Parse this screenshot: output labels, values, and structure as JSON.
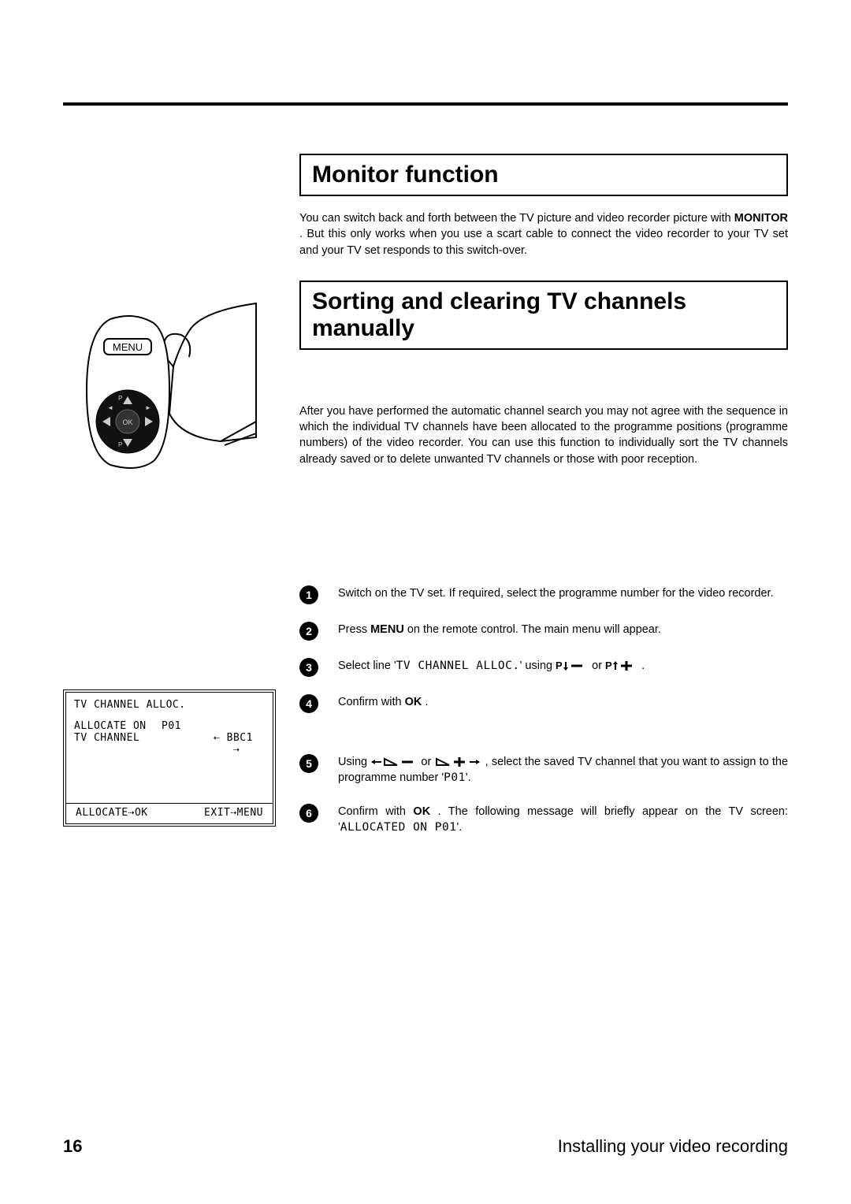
{
  "sections": {
    "monitor": {
      "title": "Monitor function",
      "para_before": "You can switch back and forth between the TV picture and video recorder picture with ",
      "monitor_btn": "MONITOR",
      "para_after": " . But this only works when you use a scart cable to connect the video recorder to your TV set and your TV set responds to this switch-over."
    },
    "sorting": {
      "title": "Sorting and clearing TV channels manually",
      "para": "After you have performed the automatic channel search you may not agree with the sequence in which the individual TV channels have been allocated to the programme positions (programme numbers) of the video recorder. You can use this function to individually sort the TV channels already saved or to delete unwanted TV channels or those with poor reception."
    }
  },
  "remote": {
    "label": "MENU",
    "ok": "OK"
  },
  "steps": [
    {
      "n": "1",
      "segments": [
        {
          "t": "text",
          "v": "Switch on the TV set. If required, select the programme number for the video recorder."
        }
      ]
    },
    {
      "n": "2",
      "segments": [
        {
          "t": "text",
          "v": "Press "
        },
        {
          "t": "bold",
          "v": "MENU"
        },
        {
          "t": "text",
          "v": " on the remote control. The main menu will appear."
        }
      ]
    },
    {
      "n": "3",
      "segments": [
        {
          "t": "text",
          "v": "Select line '"
        },
        {
          "t": "mono",
          "v": "TV CHANNEL ALLOC."
        },
        {
          "t": "text",
          "v": "' using "
        },
        {
          "t": "glyph",
          "v": "p-down-minus"
        },
        {
          "t": "text",
          "v": " or "
        },
        {
          "t": "glyph",
          "v": "p-up-plus"
        },
        {
          "t": "text",
          "v": " ."
        }
      ]
    },
    {
      "n": "4",
      "segments": [
        {
          "t": "text",
          "v": "Confirm with "
        },
        {
          "t": "bold",
          "v": "OK"
        },
        {
          "t": "text",
          "v": " ."
        }
      ]
    },
    {
      "n": "5",
      "segments": [
        {
          "t": "text",
          "v": "Using "
        },
        {
          "t": "glyph",
          "v": "left-tri-minus"
        },
        {
          "t": "text",
          "v": " or "
        },
        {
          "t": "glyph",
          "v": "tri-plus-right"
        },
        {
          "t": "text",
          "v": " , select the saved TV channel that you want to assign to the programme number '"
        },
        {
          "t": "mono",
          "v": "P01"
        },
        {
          "t": "text",
          "v": "'."
        }
      ]
    },
    {
      "n": "6",
      "segments": [
        {
          "t": "text",
          "v": "Confirm with "
        },
        {
          "t": "bold",
          "v": "OK"
        },
        {
          "t": "text",
          "v": " . The following message will briefly appear on the TV screen: '"
        },
        {
          "t": "mono",
          "v": "ALLOCATED ON P01"
        },
        {
          "t": "text",
          "v": "'."
        }
      ]
    }
  ],
  "osd": {
    "title": "TV CHANNEL ALLOC.",
    "row1_left": "ALLOCATE ON",
    "row1_right": "P01",
    "row2_left": "TV CHANNEL",
    "row2_mid_left": "⇠",
    "row2_val": "BBC1",
    "row2_mid_right": "⇢",
    "footer_left": "ALLOCATE⇢OK",
    "footer_right": "EXIT⇢MENU"
  },
  "footer": {
    "page": "16",
    "text": "Installing your video recording"
  }
}
